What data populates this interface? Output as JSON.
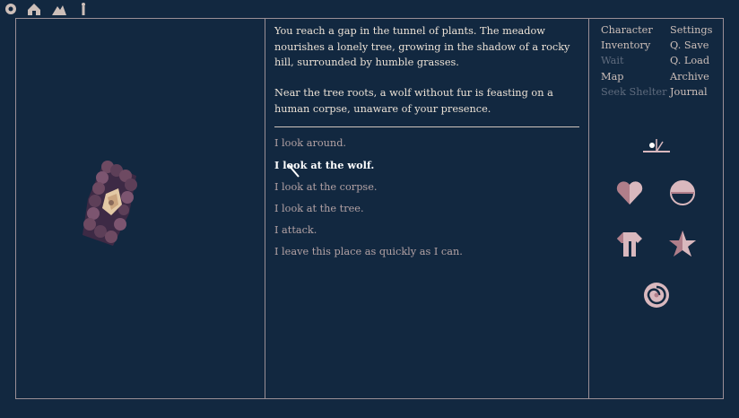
{
  "colors": {
    "background": "#122840",
    "border": "#9a8f96",
    "text": "#ece2d6",
    "choice_text": "#b3a2a4",
    "highlight_text": "#ffffff",
    "menu_text": "#cdbfb9",
    "menu_disabled": "#5f6b7d",
    "icon_pink": "#d9b8be",
    "icon_mauve": "#b07e8a"
  },
  "toolbar": {
    "icons": [
      "cog-icon",
      "house-icon",
      "mountain-icon",
      "figure-icon"
    ]
  },
  "scene": {
    "image": "tree-grove-isometric"
  },
  "narrative": {
    "paragraphs": [
      "You reach a gap in the tunnel of plants. The meadow nourishes a lonely tree, growing in the shadow of a rocky hill, surrounded by humble grasses.",
      "Near the tree roots, a wolf without fur is feasting on a human corpse, unaware of your presence."
    ]
  },
  "choices": [
    {
      "text": "I look around.",
      "highlighted": false
    },
    {
      "text": "I look at the wolf.",
      "highlighted": true
    },
    {
      "text": "I look at the corpse.",
      "highlighted": false
    },
    {
      "text": "I look at the tree.",
      "highlighted": false
    },
    {
      "text": "I attack.",
      "highlighted": false
    },
    {
      "text": "I leave this place as quickly as I can.",
      "highlighted": false
    }
  ],
  "menu": {
    "left": [
      {
        "label": "Character",
        "enabled": true
      },
      {
        "label": "Inventory",
        "enabled": true
      },
      {
        "label": "Wait",
        "enabled": false
      },
      {
        "label": "Map",
        "enabled": true
      },
      {
        "label": "Seek Shelter",
        "enabled": false
      }
    ],
    "right": [
      {
        "label": "Settings",
        "enabled": true
      },
      {
        "label": "Q. Save",
        "enabled": true
      },
      {
        "label": "Q. Load",
        "enabled": true
      },
      {
        "label": "Archive",
        "enabled": true
      },
      {
        "label": "Journal",
        "enabled": true
      }
    ]
  },
  "status_icons": [
    "sundial-icon",
    "heart-icon",
    "food-bowl-icon",
    "shirt-icon",
    "star-icon",
    "spiral-icon"
  ]
}
